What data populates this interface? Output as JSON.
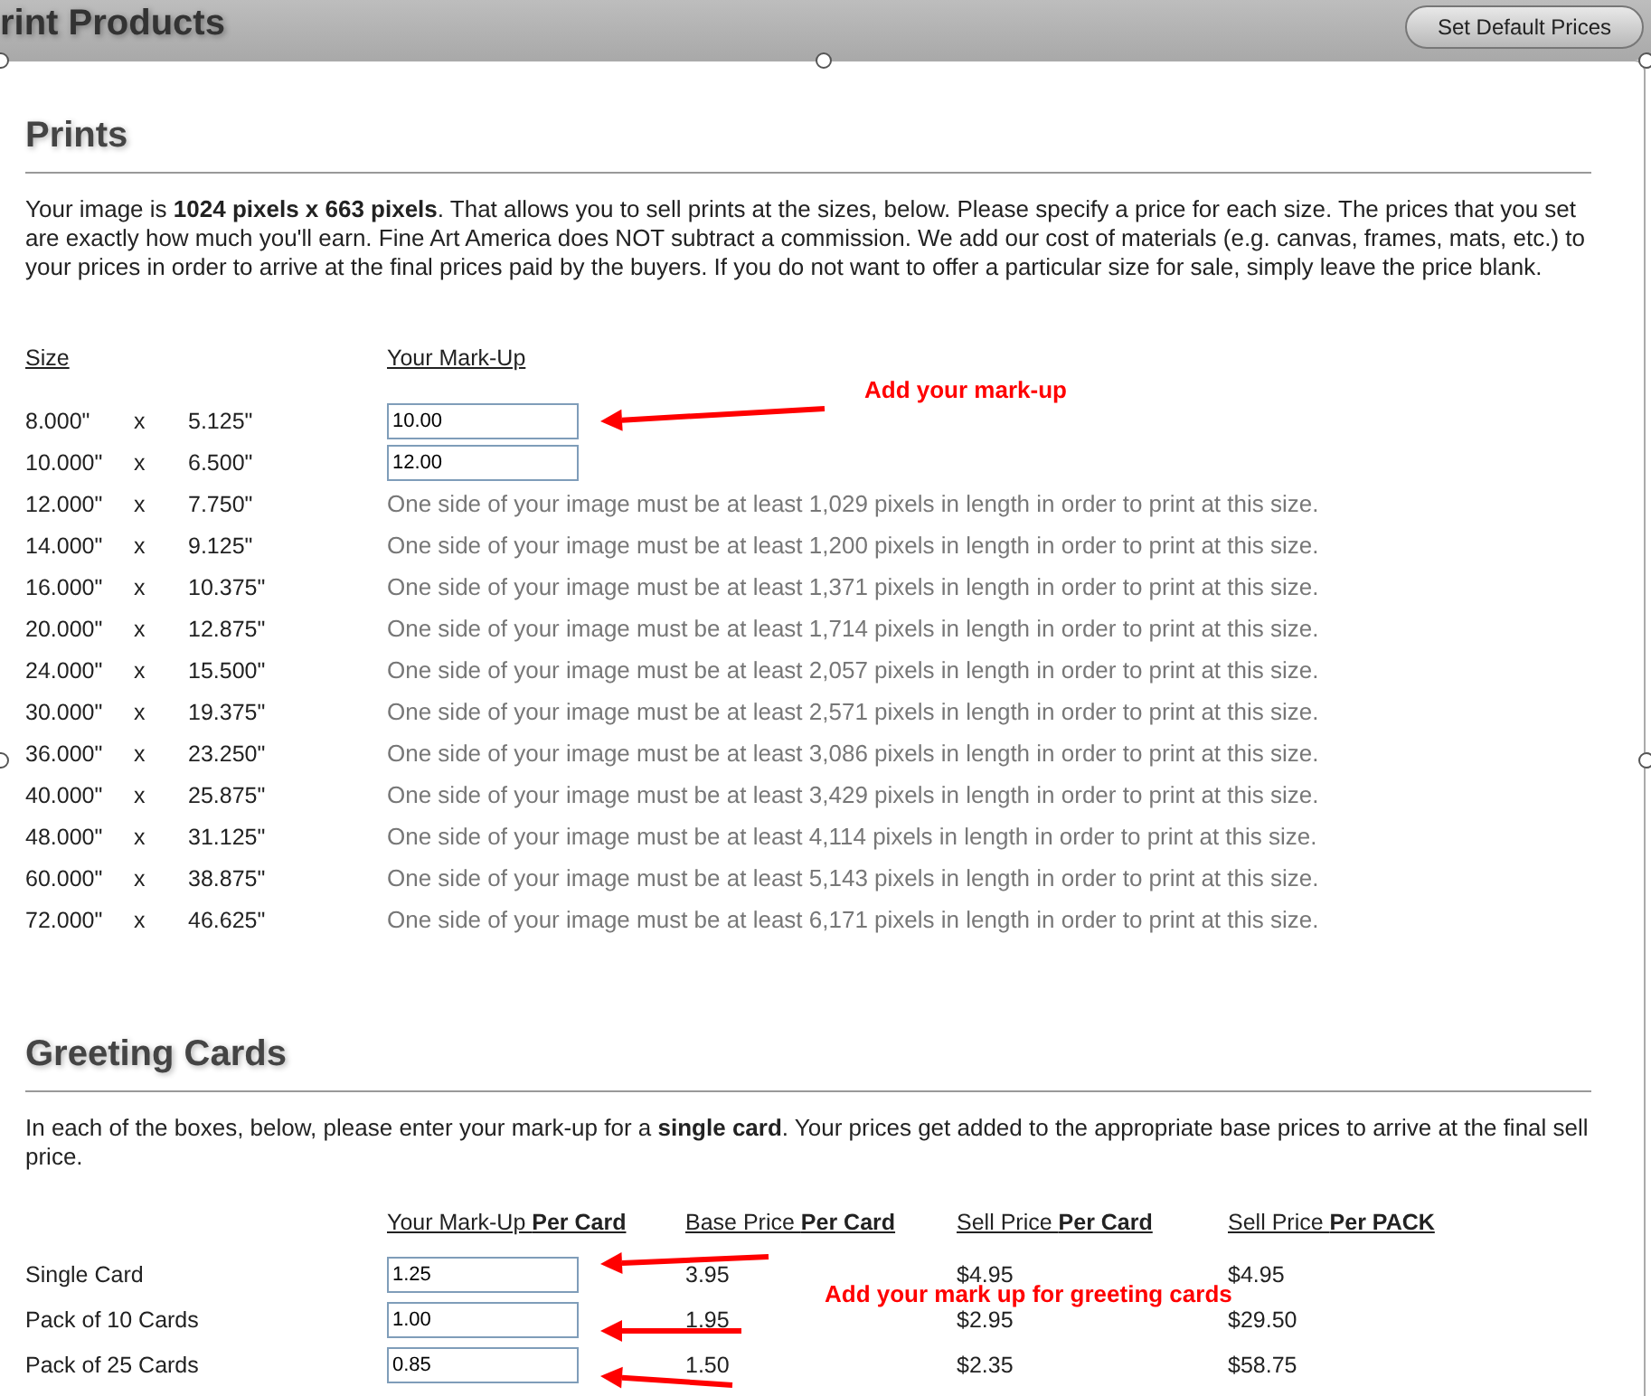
{
  "header": {
    "title": "rint Products",
    "button": "Set Default Prices"
  },
  "prints": {
    "heading": "Prints",
    "intro": "Your image is **1024 pixels x 663 pixels**.   That allows you to sell prints at the sizes, below.   Please specify a price for each size.   The prices that you set are exactly how much you'll earn.   Fine Art America does NOT subtract a commission.   We add our cost of materials (e.g. canvas, frames, mats, etc.) to your prices in order to arrive at the final prices paid by the buyers.   If you do not want to offer a particular size for sale, simply leave the price blank.",
    "columns": [
      "Size",
      "Your Mark-Up"
    ],
    "rows": [
      {
        "kind": "input",
        "width": "8.000\"",
        "x": "x",
        "height": "5.125\"",
        "value": "10.00"
      },
      {
        "kind": "input",
        "width": "10.000\"",
        "x": "x",
        "height": "6.500\"",
        "value": "12.00"
      },
      {
        "kind": "note",
        "width": "12.000\"",
        "x": "x",
        "height": "7.750\"",
        "note": "One side of your image must be at least 1,029 pixels in length in order to print at this size."
      },
      {
        "kind": "note",
        "width": "14.000\"",
        "x": "x",
        "height": "9.125\"",
        "note": "One side of your image must be at least 1,200 pixels in length in order to print at this size."
      },
      {
        "kind": "note",
        "width": "16.000\"",
        "x": "x",
        "height": "10.375\"",
        "note": "One side of your image must be at least 1,371 pixels in length in order to print at this size."
      },
      {
        "kind": "note",
        "width": "20.000\"",
        "x": "x",
        "height": "12.875\"",
        "note": "One side of your image must be at least 1,714 pixels in length in order to print at this size."
      },
      {
        "kind": "note",
        "width": "24.000\"",
        "x": "x",
        "height": "15.500\"",
        "note": "One side of your image must be at least 2,057 pixels in length in order to print at this size."
      },
      {
        "kind": "note",
        "width": "30.000\"",
        "x": "x",
        "height": "19.375\"",
        "note": "One side of your image must be at least 2,571 pixels in length in order to print at this size."
      },
      {
        "kind": "note",
        "width": "36.000\"",
        "x": "x",
        "height": "23.250\"",
        "note": "One side of your image must be at least 3,086 pixels in length in order to print at this size."
      },
      {
        "kind": "note",
        "width": "40.000\"",
        "x": "x",
        "height": "25.875\"",
        "note": "One side of your image must be at least 3,429 pixels in length in order to print at this size."
      },
      {
        "kind": "note",
        "width": "48.000\"",
        "x": "x",
        "height": "31.125\"",
        "note": "One side of your image must be at least 4,114 pixels in length in order to print at this size."
      },
      {
        "kind": "note",
        "width": "60.000\"",
        "x": "x",
        "height": "38.875\"",
        "note": "One side of your image must be at least 5,143 pixels in length in order to print at this size."
      },
      {
        "kind": "note",
        "width": "72.000\"",
        "x": "x",
        "height": "46.625\"",
        "note": "One side of your image must be at least 6,171 pixels in length in order to print at this size."
      }
    ],
    "annotation": "Add your mark-up"
  },
  "cards": {
    "heading": "Greeting Cards",
    "intro": "In each of the boxes, below, please enter your mark-up for a **single card**.   Your prices get added to the appropriate base prices to arrive at the final sell price.",
    "columns": [
      "Your Mark-Up **Per Card**",
      "Base Price **Per Card**",
      "Sell Price **Per Card**",
      "Sell Price **Per PACK**"
    ],
    "rows": [
      {
        "label": "Single Card",
        "markup": "1.25",
        "base": "3.95",
        "sell": "$4.95",
        "pack": "$4.95"
      },
      {
        "label": "Pack of 10 Cards",
        "markup": "1.00",
        "base": "1.95",
        "sell": "$2.95",
        "pack": "$29.50"
      },
      {
        "label": "Pack of 25 Cards",
        "markup": "0.85",
        "base": "1.50",
        "sell": "$2.35",
        "pack": "$58.75"
      }
    ],
    "annotation": "Add your mark up for greeting cards"
  }
}
